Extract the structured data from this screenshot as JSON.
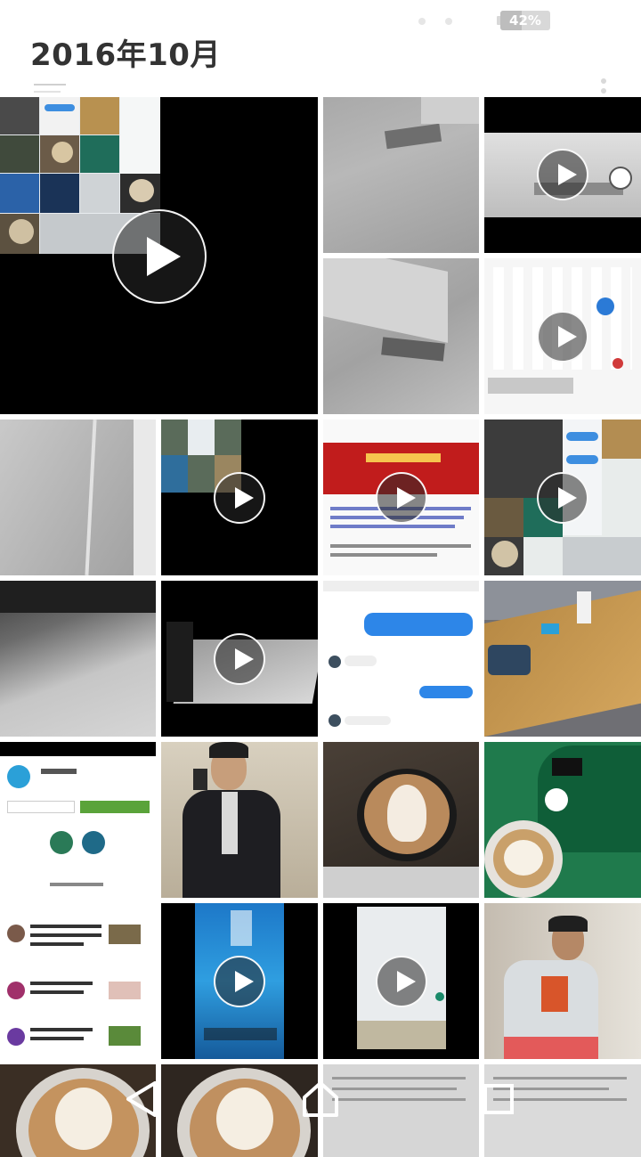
{
  "status_bar": {
    "battery_label": "42%",
    "battery_level_percent": 42,
    "battery_icon": "battery-icon"
  },
  "header": {
    "title": "2016年10月",
    "overflow_icon": "overflow-menu-icon"
  },
  "grid": {
    "items": [
      {
        "name": "thumb-screenshot-collage-video",
        "type": "video"
      },
      {
        "name": "thumb-ceiling-vent-1",
        "type": "photo"
      },
      {
        "name": "thumb-ceiling-clock-video",
        "type": "video"
      },
      {
        "name": "thumb-ceiling-vent-2",
        "type": "photo"
      },
      {
        "name": "thumb-calendar-video",
        "type": "video"
      },
      {
        "name": "thumb-wall-corner",
        "type": "photo"
      },
      {
        "name": "thumb-collage-video",
        "type": "video"
      },
      {
        "name": "thumb-red-banner-page-video",
        "type": "video"
      },
      {
        "name": "thumb-chat-collage-video",
        "type": "video"
      },
      {
        "name": "thumb-floor-door",
        "type": "photo"
      },
      {
        "name": "thumb-dark-floor-video",
        "type": "video"
      },
      {
        "name": "thumb-chat-screenshot",
        "type": "photo"
      },
      {
        "name": "thumb-meeting-table",
        "type": "photo"
      },
      {
        "name": "thumb-app-screenshot",
        "type": "photo"
      },
      {
        "name": "thumb-selfie-suit",
        "type": "photo"
      },
      {
        "name": "thumb-latte-art-1",
        "type": "photo"
      },
      {
        "name": "thumb-starbucks-latte",
        "type": "photo"
      },
      {
        "name": "thumb-feed-screenshot",
        "type": "photo"
      },
      {
        "name": "thumb-lockscreen-video",
        "type": "video"
      },
      {
        "name": "thumb-phone-calendar-video",
        "type": "video"
      },
      {
        "name": "thumb-person-hallway",
        "type": "photo"
      },
      {
        "name": "thumb-latte-art-2",
        "type": "photo"
      },
      {
        "name": "thumb-latte-art-3",
        "type": "photo"
      },
      {
        "name": "thumb-document-1",
        "type": "photo"
      },
      {
        "name": "thumb-document-2",
        "type": "photo"
      }
    ]
  },
  "nav_bar": {
    "back_icon": "back-icon",
    "home_icon": "home-icon",
    "recents_icon": "recents-icon"
  }
}
